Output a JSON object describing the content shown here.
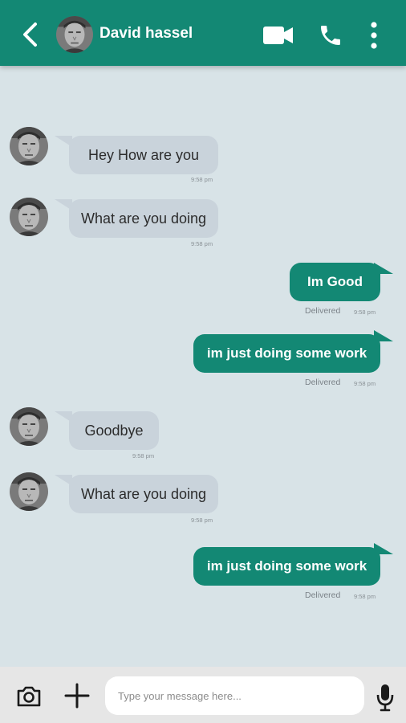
{
  "header": {
    "contact_name": "David hassel"
  },
  "messages": [
    {
      "direction": "in",
      "text": "Hey How are you",
      "time": "9:58 pm"
    },
    {
      "direction": "in",
      "text": "What are you doing",
      "time": "9:58 pm"
    },
    {
      "direction": "out",
      "text": "Im Good",
      "status": "Delivered",
      "time": "9:58 pm"
    },
    {
      "direction": "out",
      "text": "im just doing some work",
      "status": "Delivered",
      "time": "9:58 pm"
    },
    {
      "direction": "in",
      "text": "Goodbye",
      "time": "9:58 pm"
    },
    {
      "direction": "in",
      "text": "What are you doing",
      "time": "9:58 pm"
    },
    {
      "direction": "out",
      "text": "im just doing some work",
      "status": "Delivered",
      "time": "9:58 pm"
    }
  ],
  "composer": {
    "placeholder": "Type your message here..."
  },
  "icons": {
    "back": "back-arrow-icon",
    "video": "video-camera-icon",
    "call": "phone-icon",
    "menu": "more-vert-icon",
    "camera": "camera-icon",
    "attach": "plus-icon",
    "mic": "microphone-icon"
  },
  "colors": {
    "brand": "#138874",
    "background": "#d8e3e7",
    "incoming_bubble": "#c9d3db",
    "outgoing_bubble": "#138874",
    "composer_bar": "#e6e6e6"
  }
}
